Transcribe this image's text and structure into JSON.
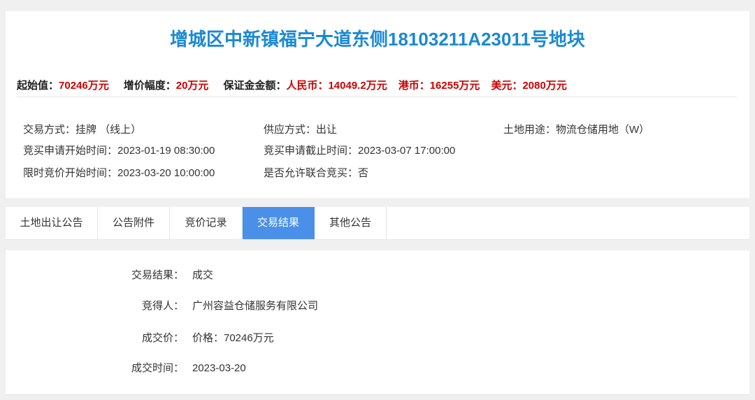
{
  "title": "增城区中新镇福宁大道东侧18103211A23011号地块",
  "colors": {
    "title": "#1a89d4",
    "value_red": "#cc0000",
    "accent": "#4a90e8",
    "page_bg": "#f0f0f0"
  },
  "summary": {
    "start_price": {
      "label": "起始值：",
      "value": "70246万元"
    },
    "increment": {
      "label": "增价幅度：",
      "value": "20万元"
    },
    "deposit": {
      "label": "保证金金额：",
      "currencies": [
        {
          "label": "人民币：",
          "value": "14049.2万元"
        },
        {
          "label": "港币：",
          "value": "16255万元"
        },
        {
          "label": "美元：",
          "value": "2080万元"
        }
      ]
    }
  },
  "info": {
    "trade_method": {
      "label": "交易方式：",
      "value": "挂牌 （线上）"
    },
    "supply_method": {
      "label": "供应方式：",
      "value": "出让"
    },
    "land_use": {
      "label": "土地用途：",
      "value": "物流仓储用地（W）"
    },
    "apply_start": {
      "label": "竞买申请开始时间：",
      "value": "2023-01-19 08:30:00"
    },
    "apply_end": {
      "label": "竞买申请截止时间：",
      "value": "2023-03-07 17:00:00"
    },
    "bid_start": {
      "label": "限时竞价开始时间：",
      "value": "2023-03-20 10:00:00"
    },
    "joint_bid": {
      "label": "是否允许联合竞买：",
      "value": "否"
    }
  },
  "tabs": [
    {
      "label": "土地出让公告"
    },
    {
      "label": "公告附件"
    },
    {
      "label": "竞价记录"
    },
    {
      "label": "交易结果"
    },
    {
      "label": "其他公告"
    }
  ],
  "active_tab_index": 3,
  "result": {
    "rows": [
      {
        "label": "交易结果：",
        "value": "成交"
      },
      {
        "label": "竞得人：",
        "value": "广州容益仓储服务有限公司"
      },
      {
        "label": "成交价：",
        "value": "价格：70246万元"
      },
      {
        "label": "成交时间：",
        "value": "2023-03-20"
      }
    ]
  }
}
